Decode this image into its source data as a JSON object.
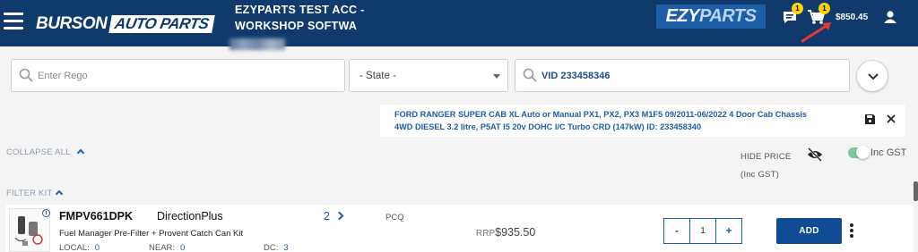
{
  "header": {
    "logo_brand": "BURSON",
    "logo_suffix": "AUTO PARTS",
    "account_line1": "EZYPARTS TEST ACC -",
    "account_line2": "WORKSHOP SOFTWA",
    "ezy_logo_1": "EZY",
    "ezy_logo_2": "PARTS",
    "messages_badge": "1",
    "cart_badge": "1",
    "cart_total": "$850.45",
    "icons": [
      "hamburger-menu-icon",
      "message-icon",
      "cart-icon",
      "user-icon"
    ],
    "colors": {
      "header_bg": "#0f3a6b",
      "badge": "#ffd200",
      "arrow": "#e53935"
    }
  },
  "search": {
    "rego_placeholder": "Enter Rego",
    "state_value": "- State -",
    "vid_value": "VID 233458346"
  },
  "vehicle": {
    "line1": "FORD RANGER SUPER CAB XL Auto or Manual PX1, PX2, PX3 M1F5 09/2011-06/2022 4 Door Cab Chassis",
    "line2": "4WD DIESEL 3.2 litre, P5AT I5 20v DOHC I/C Turbo CRD (147kW) ID: 233458340"
  },
  "controls": {
    "collapse_all": "COLLAPSE ALL",
    "hide_price": "HIDE PRICE",
    "inc_gst_sub": "(Inc GST)",
    "inc_gst_toggle": "Inc GST",
    "toggle_on": true
  },
  "category": {
    "name": "FILTER KIT"
  },
  "product": {
    "code": "FMPV661DPK",
    "brand": "DirectionPlus",
    "description": "Fuel Manager Pre-Filter + Provent Catch Can Kit",
    "local_label": "LOCAL:",
    "local_value": "0",
    "near_label": "NEAR:",
    "near_value": "0",
    "dc_label": "DC:",
    "dc_value": "3",
    "count": "2",
    "pcq": "PCQ",
    "rrp_label": "RRP",
    "rrp_price": "$935.50",
    "qty_minus": "-",
    "qty_value": "1",
    "qty_plus": "+",
    "add_label": "ADD"
  }
}
